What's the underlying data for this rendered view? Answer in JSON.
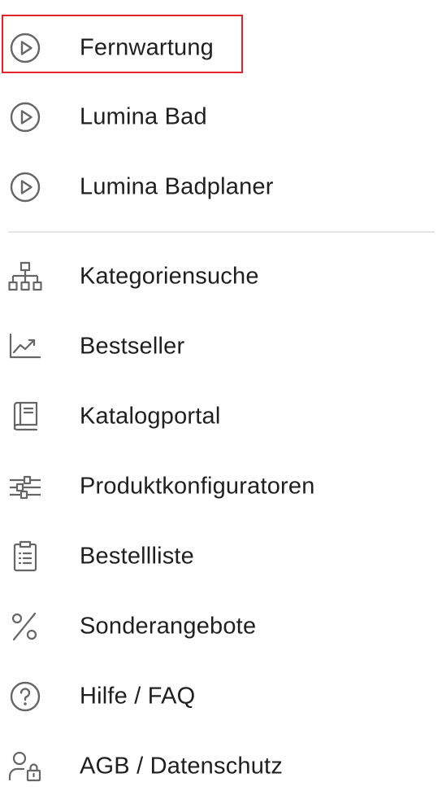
{
  "menu": {
    "items": [
      {
        "label": "Fernwartung",
        "icon": "play-circle-icon"
      },
      {
        "label": "Lumina Bad",
        "icon": "play-circle-icon"
      },
      {
        "label": "Lumina Badplaner",
        "icon": "play-circle-icon"
      },
      {
        "label": "Kategoriensuche",
        "icon": "sitemap-icon"
      },
      {
        "label": "Bestseller",
        "icon": "trending-up-chart-icon"
      },
      {
        "label": "Katalogportal",
        "icon": "book-icon"
      },
      {
        "label": "Produktkonfiguratoren",
        "icon": "sliders-icon"
      },
      {
        "label": "Bestellliste",
        "icon": "clipboard-list-icon"
      },
      {
        "label": "Sonderangebote",
        "icon": "percent-icon"
      },
      {
        "label": "Hilfe / FAQ",
        "icon": "help-circle-icon"
      },
      {
        "label": "AGB / Datenschutz",
        "icon": "user-lock-icon"
      }
    ]
  },
  "colors": {
    "highlight_border": "#e0242b",
    "icon_stroke": "#666666",
    "text": "#1f1f1f",
    "divider": "#e6e6e6"
  }
}
